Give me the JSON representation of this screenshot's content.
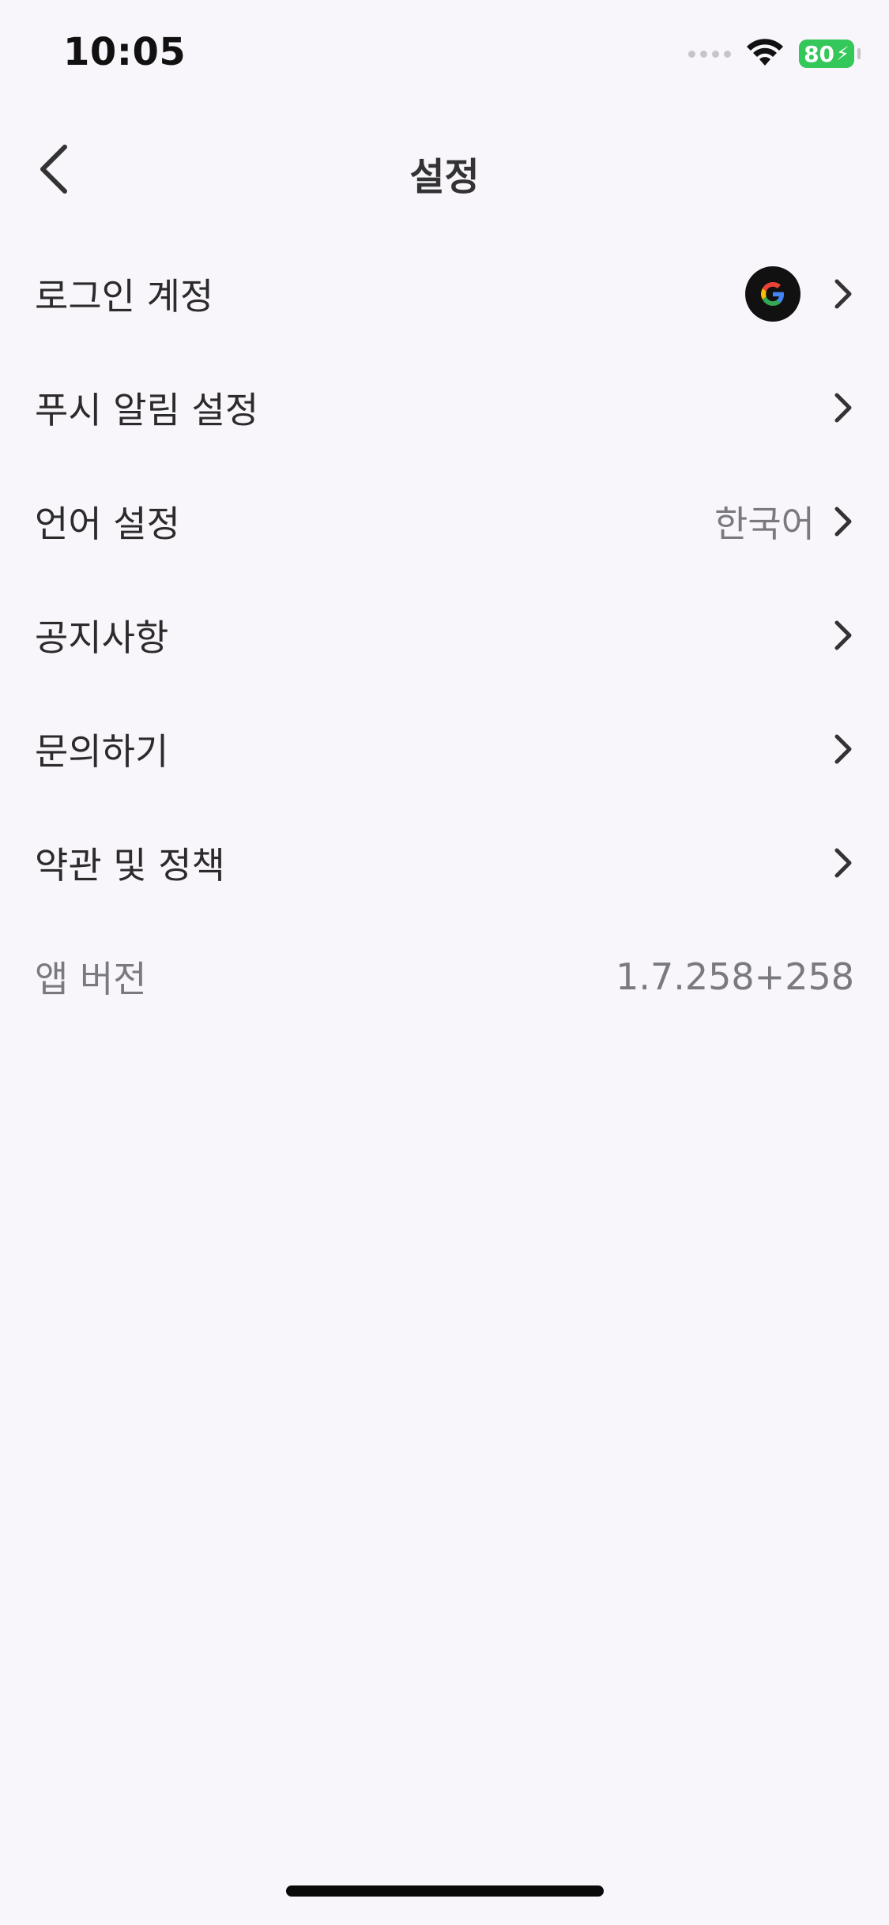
{
  "status_bar": {
    "time": "10:05",
    "battery_level": "80",
    "battery_color": "#34c759"
  },
  "nav": {
    "title": "설정",
    "back_icon": "chevron-left-icon"
  },
  "rows": [
    {
      "label": "로그인 계정",
      "value": "",
      "icon": "google-icon",
      "has_chevron": true
    },
    {
      "label": "푸시 알림 설정",
      "value": "",
      "has_chevron": true
    },
    {
      "label": "언어 설정",
      "value": "한국어",
      "has_chevron": true
    },
    {
      "label": "공지사항",
      "value": "",
      "has_chevron": true
    },
    {
      "label": "문의하기",
      "value": "",
      "has_chevron": true
    },
    {
      "label": "약관 및 정책",
      "value": "",
      "has_chevron": true
    }
  ],
  "version_row": {
    "label": "앱 버전",
    "value": "1.7.258+258"
  },
  "colors": {
    "background": "#f8f5fb",
    "text_primary": "#2b2b2b",
    "text_secondary": "#7a7a7e"
  }
}
